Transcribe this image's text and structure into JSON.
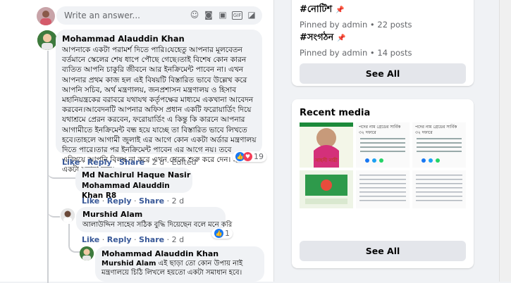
{
  "comment_box": {
    "placeholder": "Write an answer..."
  },
  "comment_box_icons": [
    "emoji-icon",
    "camera-icon",
    "image-icon",
    "gif-icon",
    "sticker-icon"
  ],
  "comment": {
    "author": "Mohammad Alauddin Khan",
    "text": "আপনাকে একটা পরামর্শ দিতে পারি।যেহেতু আপনার মূলবেতন বর্তমানে স্কেলের শেষ ধাপে পৌছে গেছে।তাই বিশেষ কোন কারন ব্যতিত আপনি চাকুরি জীবনে আর ইনক্রিমেন্ট পাবেন না। এখন আপনার প্রথম কাজ হল এই বিষয়টি বিস্তারিত ভাবে উল্লেখ করে আপনি সচিব, অর্থ মন্ত্রণালয়, জনপ্রশাসন মন্ত্রণালয় ও হিসাব মহানিয়ন্ত্রকের বরাবরে যথাযথ কর্তৃপক্ষের মাধ্যমে একখানা আবেদন করবেন।আবেদনটি আপনার অফিস প্রধান একটি ফরোয়ার্ডিং দিয়ে যথাশ্রমে প্রেরন করবেন, ফরোয়ার্ডিং এ কিন্তু কি কারনে আপনার আগামীতে ইনক্রিমেন্ট বন্ধ হয়ে যাচ্ছে তা বিস্তারিত ভাবে লিখতে হবে।তাহলে আগামী জুলাই এর আগে কোন একটা অর্ডার মন্ত্রণালয় দিতে পারে।তার পর ইনক্রিমেন্ট পাবেন এর আগে নয়। তবে এবিষয়ে আপনি বিলম্ব না করে এখন থেকে শুরু করে দেন। হয়তো একটা সুরাহা হবে।",
    "actions": {
      "like": "Like",
      "reply": "Reply",
      "share": "Share",
      "time": "2 d",
      "edited": "Edited"
    },
    "reaction_count": "19"
  },
  "replies": [
    {
      "author": "Md Nachirul Haque Nasir",
      "text": "Mohammad Alauddin Khan R8",
      "actions": {
        "like": "Like",
        "reply": "Reply",
        "share": "Share",
        "time": "2 d"
      }
    },
    {
      "author": "Murshid Alam",
      "text": "আলাউদ্দিন সাহেব সঠিক বুদ্ধি দিয়েছেন বলে মনে করি",
      "actions": {
        "like": "Like",
        "reply": "Reply",
        "share": "Share",
        "time": "2 d"
      },
      "reaction_count": "1"
    },
    {
      "author": "Mohammad Alauddin Khan",
      "mention": "Murshid Alam",
      "text": "এই ছাড়া তো কোন উপায় নাই মন্ত্রণালয়ে চিঠি লিখলে হয়তো একটা সমাধান হবে।"
    }
  ],
  "groups_card": {
    "items": [
      {
        "title": "#নোটিশ",
        "meta": "Pinned by admin • 22 posts"
      },
      {
        "title": "#সংগঠন",
        "meta": "Pinned by admin • 14 posts"
      }
    ],
    "see_all": "See All"
  },
  "media_card": {
    "title": "Recent media",
    "see_all": "See All",
    "thumb_texts": [
      "সাহসী নারী",
      "পদের নাম গ্রেডের সার্বিক ৩২ দফারে",
      "পদের নাম গ্রেডের সার্বিক ৩২ দফারে"
    ]
  },
  "colors": {
    "link": "#385898",
    "bubble": "#f0f2f5",
    "accent": "#1877f2"
  }
}
